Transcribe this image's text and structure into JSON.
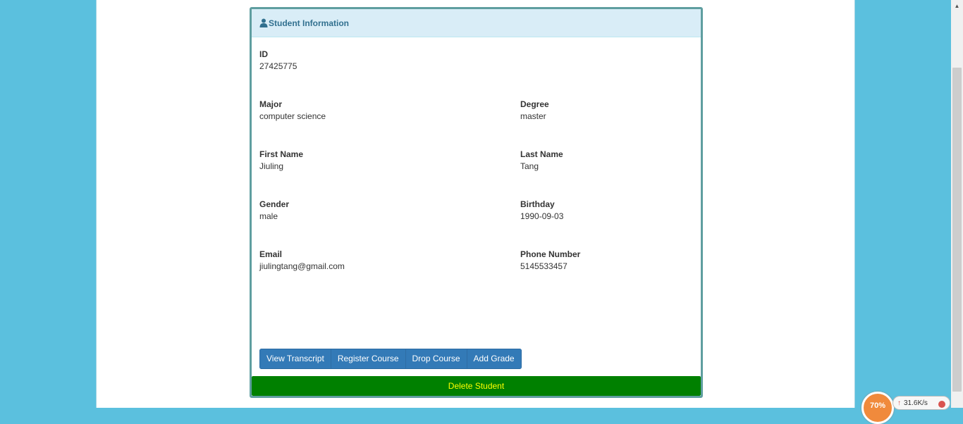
{
  "panel": {
    "heading": "Student Information",
    "heading_icon": "user-icon"
  },
  "fields": {
    "id": {
      "label": "ID",
      "value": "27425775"
    },
    "major": {
      "label": "Major",
      "value": "computer science"
    },
    "degree": {
      "label": "Degree",
      "value": "master"
    },
    "first_name": {
      "label": "First Name",
      "value": "Jiuling"
    },
    "last_name": {
      "label": "Last Name",
      "value": "Tang"
    },
    "gender": {
      "label": "Gender",
      "value": "male"
    },
    "birthday": {
      "label": "Birthday",
      "value": "1990-09-03"
    },
    "email": {
      "label": "Email",
      "value": "jiulingtang@gmail.com"
    },
    "phone": {
      "label": "Phone Number",
      "value": "5145533457"
    }
  },
  "actions": {
    "view_transcript": "View Transcript",
    "register_course": "Register Course",
    "drop_course": "Drop Course",
    "add_grade": "Add Grade",
    "delete_student": "Delete Student"
  },
  "net_widget": {
    "percent": "70%",
    "speed": "31.6K/s"
  },
  "colors": {
    "background": "#5bc0de",
    "panel_border": "#5f9ea0",
    "heading_bg": "#d9edf7",
    "heading_text": "#31708f",
    "button_primary": "#337ab7",
    "delete_bg": "#008000",
    "delete_text": "#ffff00"
  }
}
